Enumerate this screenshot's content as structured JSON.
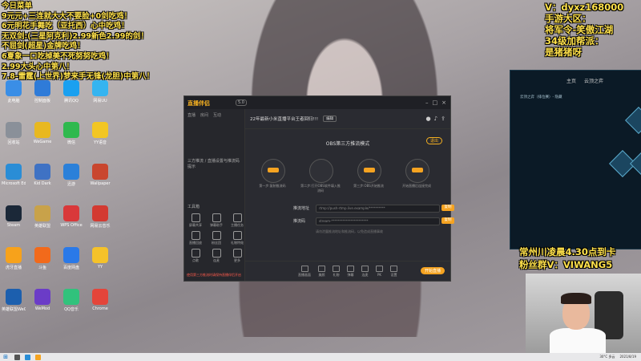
{
  "overlay": {
    "menu_lines": [
      "今日菜单",
      "9元元+三连就大大不要脸+0剑吃鸡！",
      "6元明花手舞吃（亚托西）心中吃鸡！",
      "无双剑:(三星阿克利)2.99新色2.99的剑！",
      "不屈剑(超星)金牌吃鸡！",
      "6夏象一口吃掉美不死努努吃鸡！",
      "2.99大头心中第八！",
      "7.8-雷霆(上世界)梦来手无锋(龙胆)中第八！"
    ],
    "contact_lines": [
      "V：dyxz168000",
      "手游大区：",
      "将军令-笑傲江湖",
      "34级加帮派：",
      "是猪猪呀"
    ],
    "ticker_lines": [
      "常州川凌晨4.30点到卡",
      "粉丝群V：VIWANG5"
    ]
  },
  "desktop_icons": [
    {
      "label": "此电脑",
      "color": "#3a8ee6"
    },
    {
      "label": "控制面板",
      "color": "#2f7bd8"
    },
    {
      "label": "腾讯QQ",
      "color": "#1aa0f0"
    },
    {
      "label": "网易UU",
      "color": "#35b4f0"
    },
    {
      "label": "回收站",
      "color": "#8a9099"
    },
    {
      "label": "WeGame",
      "color": "#e8b820"
    },
    {
      "label": "微信",
      "color": "#2fb94e"
    },
    {
      "label": "YY语音",
      "color": "#f2c623"
    },
    {
      "label": "Microsoft Edge",
      "color": "#2a8dd6"
    },
    {
      "label": "Kid Dark",
      "color": "#3f72c4"
    },
    {
      "label": "迅游",
      "color": "#2b80d9"
    },
    {
      "label": "Wallpaper",
      "color": "#c9462e"
    },
    {
      "label": "Steam",
      "color": "#1b2838"
    },
    {
      "label": "英雄联盟",
      "color": "#c8a24a"
    },
    {
      "label": "WPS Office",
      "color": "#d9383a"
    },
    {
      "label": "网易云音乐",
      "color": "#d33a31"
    },
    {
      "label": "虎牙直播",
      "color": "#f7a21b"
    },
    {
      "label": "斗鱼",
      "color": "#f26a1b"
    },
    {
      "label": "百度网盘",
      "color": "#2a79e8"
    },
    {
      "label": "YY",
      "color": "#f5c22a"
    },
    {
      "label": "英雄联盟WeGame版",
      "color": "#1c5fae"
    },
    {
      "label": "WeMod",
      "color": "#6b3cc7"
    },
    {
      "label": "QQ音乐",
      "color": "#31c27c"
    },
    {
      "label": "Chrome",
      "color": "#e4453a"
    }
  ],
  "app": {
    "logo": "直播伴侣",
    "version": "5.0",
    "side_tabs": [
      "直播",
      "房间",
      "互动"
    ],
    "side_desc": "三方推流 / 直播设置与推流码提示",
    "tools_header": "工具箱",
    "tools": [
      "屏幕共享",
      "弹幕助手",
      "主播任务",
      "直播回放",
      "粉丝团",
      "礼物特效",
      "点歌",
      "连麦",
      "更多"
    ],
    "bottom_tip": "使用第三方推流时请保持直播伴侣开启",
    "room_title": "22年最新小米直播平台王者回归!!!",
    "room_button": "编辑",
    "mode_title": "OBS第三方推流模式",
    "exit_button": "退出",
    "steps": [
      "第一步:复制推流码",
      "第二步:打开OBS软件填入推流码",
      "第三步:OBS开始推流",
      "开始直播后连接完成"
    ],
    "step_badges": [
      "OBS",
      "OBS",
      "推流",
      "开播"
    ],
    "fields": [
      {
        "label": "推流地址",
        "value": "rtmp://push-rtmp.live.example/**********"
      },
      {
        "label": "推流码",
        "value": "stream-***********************"
      }
    ],
    "copy_label": "复制",
    "hint": "请勿泄露推流地址和推流码，以免造成直播事故",
    "toolbar": [
      "直播画面",
      "美颜",
      "礼物",
      "弹幕",
      "连麦",
      "PK",
      "设置"
    ],
    "live_button": "开始直播"
  },
  "game_panel": {
    "tabs": [
      "主页",
      "云顶之弈"
    ],
    "subtitle": "云顶之弈（排位赛）- 隐藏",
    "side_label": "对战"
  },
  "taskbar": {
    "weather": "30°C 多云",
    "time": "2021/8/19"
  }
}
